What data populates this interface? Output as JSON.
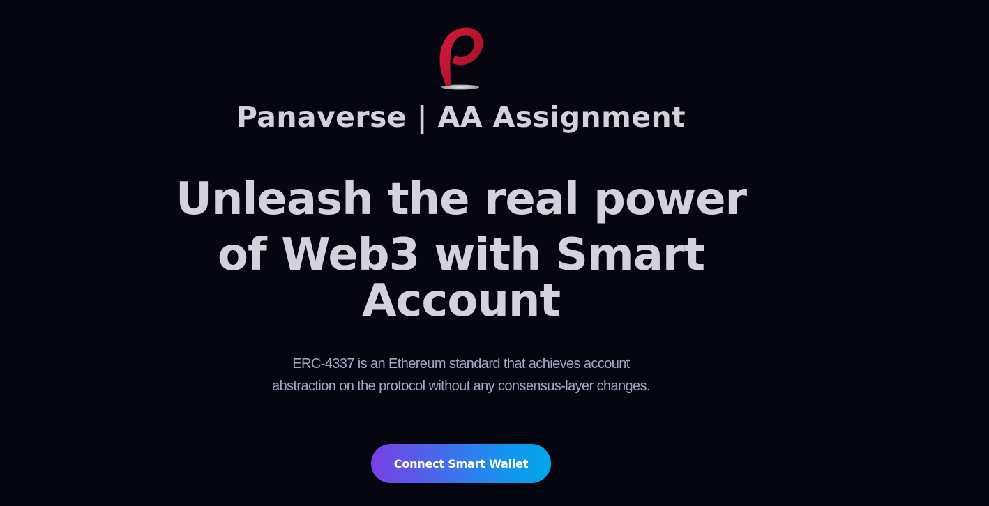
{
  "brand": {
    "logo_icon": "panaverse-pin-logo-icon",
    "logo_color": "#c1122f",
    "site_title": "Panaverse | AA Assignment"
  },
  "hero": {
    "heading_line1": "Unleash the real power",
    "heading_line2": "of Web3 with Smart",
    "heading_line3": "Account",
    "subtitle": "ERC-4337 is an Ethereum standard that achieves account abstraction on the protocol without any consensus-layer changes."
  },
  "cta": {
    "connect_label": "Connect Smart Wallet",
    "gradient_start": "#7b3fe4",
    "gradient_end": "#00a8e8"
  },
  "theme": {
    "background": "#05060f",
    "text": "#d2d1dc",
    "muted_text": "#a7a6c3"
  }
}
